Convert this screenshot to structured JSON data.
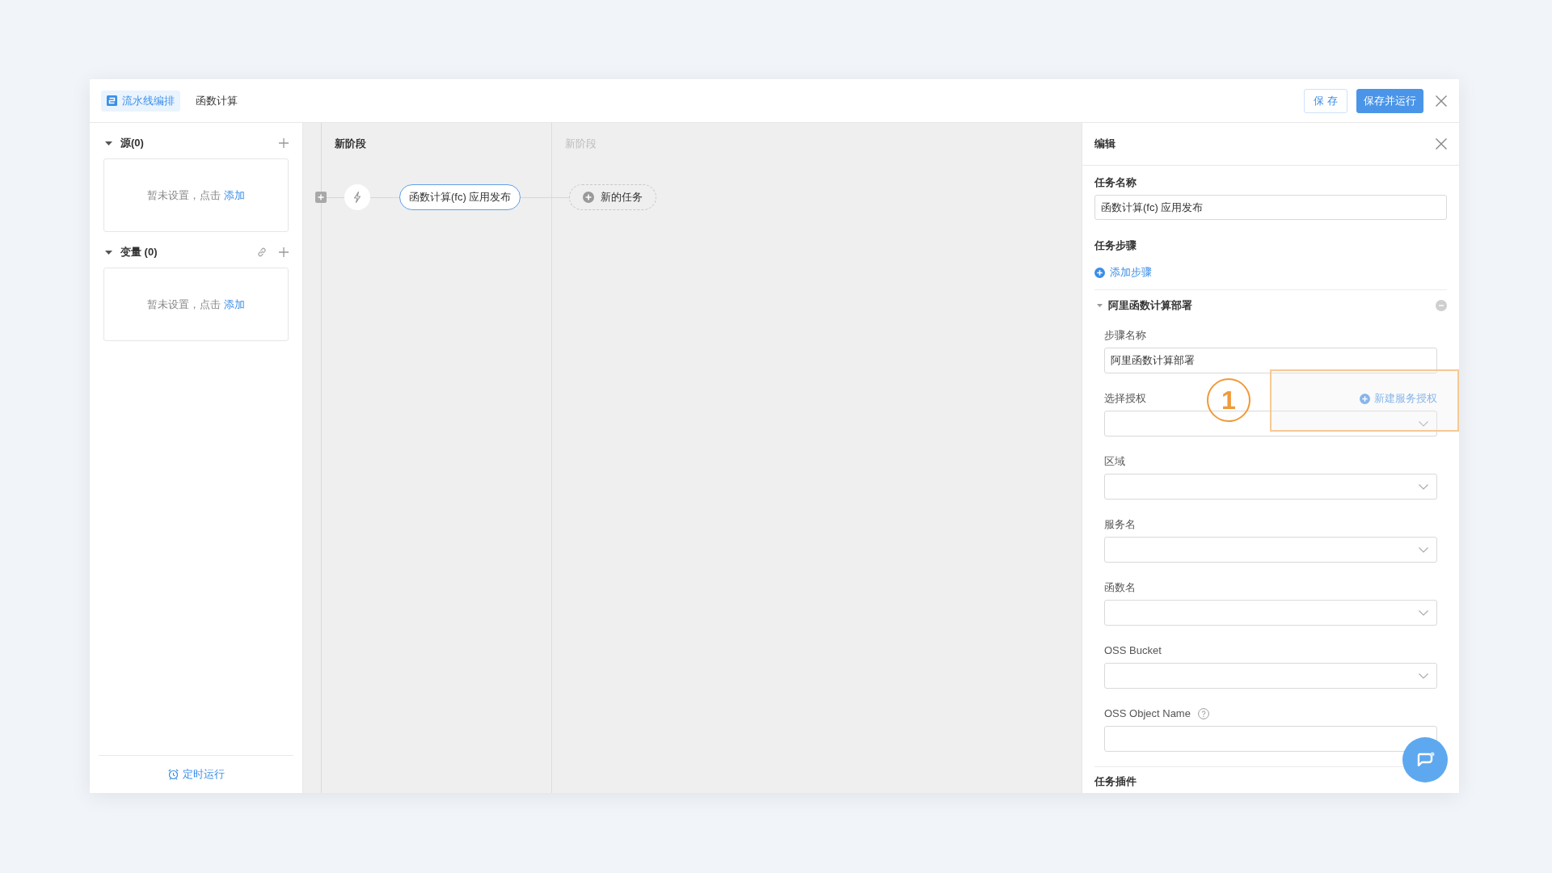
{
  "window": {
    "tabs": [
      {
        "label": "流水线编排",
        "selected": true,
        "kind": "icon"
      },
      {
        "label": "函数计算",
        "selected": false,
        "kind": "plain"
      }
    ],
    "buttons": [
      {
        "label": "保 存",
        "kind": "secondary"
      },
      {
        "label": "保存并运行",
        "kind": "primary"
      }
    ]
  },
  "sidebar": {
    "sections": [
      {
        "title": "源(0)",
        "expanded": true,
        "linkable": false,
        "empty_text": "暂未设置，点击",
        "add_link": "添加"
      },
      {
        "title": "变量 (0)",
        "expanded": true,
        "linkable": true,
        "empty_text": "暂未设置，点击",
        "add_link": "添加"
      }
    ],
    "schedule_link": "定时运行"
  },
  "canvas": {
    "stages": [
      {
        "title": "新阶段",
        "kind": "active",
        "tasks": [
          {
            "label": "函数计算(fc) 应用发布",
            "kind": "task"
          }
        ]
      },
      {
        "title": "新阶段",
        "kind": "placeholder",
        "tasks": [
          {
            "label": "新的任务",
            "kind": "new"
          }
        ]
      }
    ]
  },
  "editor": {
    "title": "编辑",
    "task_name": {
      "label": "任务名称",
      "value": "函数计算(fc) 应用发布"
    },
    "steps_title": "任务步骤",
    "add_step": "添加步骤",
    "steps": [
      {
        "title": "阿里函数计算部署",
        "expanded": true,
        "fields": [
          {
            "kind": "input",
            "label": "步骤名称",
            "value": "阿里函数计算部署",
            "help": false
          },
          {
            "kind": "select",
            "label": "选择授权",
            "action": "新建服务授权",
            "help": false
          },
          {
            "kind": "select",
            "label": "区域",
            "help": false
          },
          {
            "kind": "select",
            "label": "服务名",
            "help": false
          },
          {
            "kind": "select",
            "label": "函数名",
            "help": false
          },
          {
            "kind": "select",
            "label": "OSS Bucket",
            "help": false
          },
          {
            "kind": "input",
            "label": "OSS Object Name",
            "help": true
          }
        ]
      }
    ],
    "plugins_title": "任务插件"
  },
  "annotation": {
    "label": "1"
  }
}
